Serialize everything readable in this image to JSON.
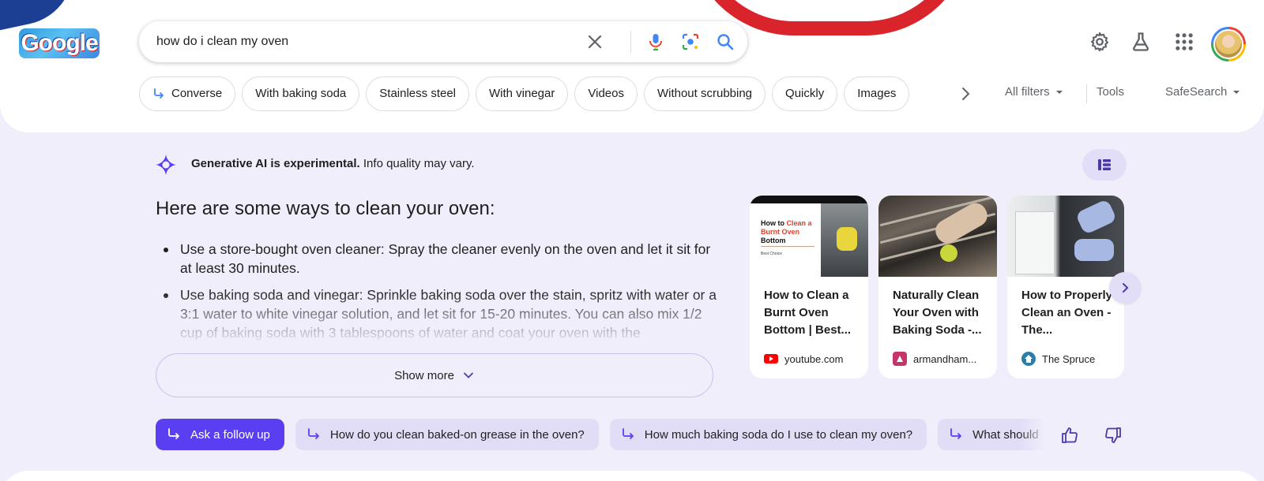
{
  "search": {
    "query": "how do i clean my oven",
    "icons": [
      "clear-icon",
      "microphone-icon",
      "lens-icon",
      "search-icon"
    ]
  },
  "header": {
    "logo_text": "Google",
    "icons": [
      "gear-icon",
      "labs-flask-icon",
      "apps-grid-icon",
      "avatar"
    ]
  },
  "chips": [
    {
      "label": "Converse",
      "icon": "arrow-turn-icon"
    },
    {
      "label": "With baking soda"
    },
    {
      "label": "Stainless steel"
    },
    {
      "label": "With vinegar"
    },
    {
      "label": "Videos"
    },
    {
      "label": "Without scrubbing"
    },
    {
      "label": "Quickly"
    },
    {
      "label": "Images"
    }
  ],
  "tools": {
    "all_filters": "All filters",
    "tools": "Tools",
    "safesearch": "SafeSearch"
  },
  "ai_overview": {
    "note_bold": "Generative AI is experimental.",
    "note_rest": " Info quality may vary.",
    "heading": "Here are some ways to clean your oven:",
    "bullets": [
      "Use a store-bought oven cleaner: Spray the cleaner evenly on the oven and let it sit for at least 30 minutes.",
      "Use baking soda and vinegar: Sprinkle baking soda over the stain, spritz with water or a 3:1 water to white vinegar solution, and let sit for 15-20 minutes. You can also mix 1/2 cup of baking soda with 3 tablespoons of water and coat your oven with the"
    ],
    "show_more": "Show more"
  },
  "cards": [
    {
      "title": "How to Clean a Burnt Oven Bottom | Best...",
      "source": "youtube.com",
      "thumb_title_black": "How to ",
      "thumb_title_red": "Clean a Burnt Oven",
      "thumb_title_black2": " Bottom",
      "thumb_caption": "Best Choice",
      "favicon_color": "#ff0000"
    },
    {
      "title": "Naturally Clean Your Oven with Baking Soda -...",
      "source": "armandham...",
      "favicon_color": "#c4366a"
    },
    {
      "title": "How to Properly Clean an Oven - The...",
      "source": "The Spruce",
      "favicon_color": "#2a7fa8"
    }
  ],
  "follow_ups": {
    "ask": "Ask a follow up",
    "questions": [
      "How do you clean baked-on grease in the oven?",
      "How much baking soda do I use to clean my oven?",
      "What should I use to clean my oven?"
    ]
  },
  "colors": {
    "accent": "#5a3ef2",
    "ai_background": "#f0eefa",
    "chip_background": "#e2ddf6"
  }
}
